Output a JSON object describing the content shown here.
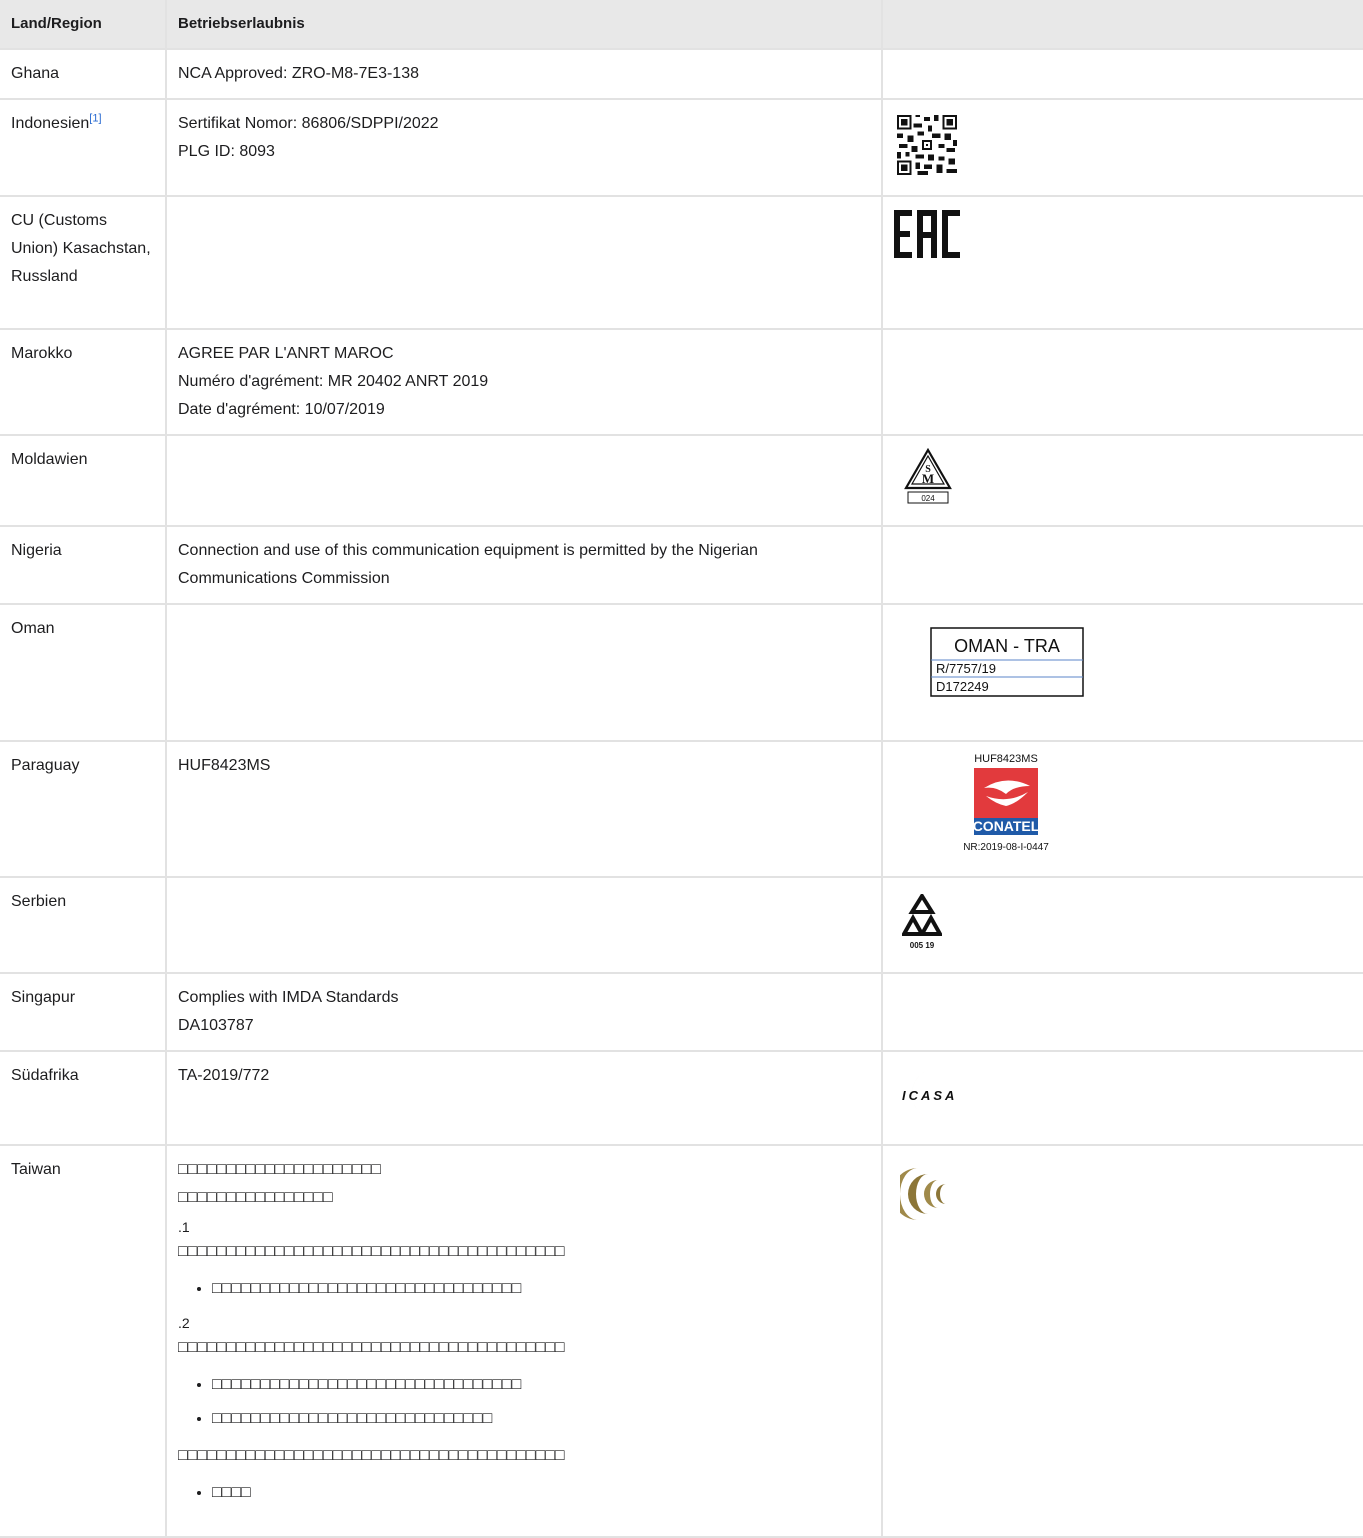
{
  "header": {
    "col1": "Land/Region",
    "col2": "Betriebserlaubnis",
    "col3": ""
  },
  "rows": [
    {
      "country": "Ghana",
      "permit_lines": [
        "NCA Approved: ZRO-M8-7E3-138"
      ]
    },
    {
      "country": "Indonesien",
      "footnote": "[1]",
      "permit_lines": [
        "Sertifikat Nomor: 86806/SDPPI/2022",
        "PLG ID: 8093"
      ],
      "mark": "qr-code"
    },
    {
      "country": "CU (Customs Union) Kasachstan, Russland",
      "permit_lines": [],
      "mark": "eac-mark",
      "mark_text": "EAC"
    },
    {
      "country": "Marokko",
      "permit_lines": [
        "AGREE PAR L'ANRT MAROC",
        "Numéro d'agrément: MR 20402 ANRT 2019",
        "Date d'agrément: 10/07/2019"
      ]
    },
    {
      "country": "Moldawien",
      "permit_lines": [],
      "mark": "sm-mark",
      "mark_text": [
        "S",
        "M",
        "024"
      ]
    },
    {
      "country": "Nigeria",
      "permit_lines": [
        "Connection and use of this communication equipment is permitted by the Nigerian Communications Commission"
      ]
    },
    {
      "country": "Oman",
      "permit_lines": [],
      "mark": "oman-tra-label",
      "mark_text": [
        "OMAN - TRA",
        "R/7757/19",
        "D172249"
      ]
    },
    {
      "country": "Paraguay",
      "permit_lines": [
        "HUF8423MS"
      ],
      "mark": "conatel-logo",
      "mark_text": [
        "HUF8423MS",
        "CONATEL",
        "NR:2019-08-I-0447"
      ]
    },
    {
      "country": "Serbien",
      "permit_lines": [],
      "mark": "serbia-triangle-mark",
      "mark_text": "005 19"
    },
    {
      "country": "Singapur",
      "permit_lines": [
        "Complies with IMDA Standards",
        "DA103787"
      ]
    },
    {
      "country": "Südafrika",
      "permit_lines": [
        "TA-2019/772"
      ],
      "mark": "icasa-logo",
      "mark_text": "ICASA"
    },
    {
      "country": "Taiwan",
      "mark": "ncc-logo"
    }
  ],
  "taiwan": {
    "line1": "□□□□□□□□□□□□□□□□□□□□□",
    "line2": "□□□□□□□□□□□□□□□□",
    "num1": ".1",
    "para1": "□□□□□□□□□□□□□□□□□□□□□□□□□□□□□□□□□□□□□□□□",
    "bullets1": [
      "□□□□□□□□□□□□□□□□□□□□□□□□□□□□□□□□"
    ],
    "num2": ".2",
    "para2": "□□□□□□□□□□□□□□□□□□□□□□□□□□□□□□□□□□□□□□□□",
    "bullets2": [
      "□□□□□□□□□□□□□□□□□□□□□□□□□□□□□□□□",
      "□□□□□□□□□□□□□□□□□□□□□□□□□□□□□"
    ],
    "para3": "□□□□□□□□□□□□□□□□□□□□□□□□□□□□□□□□□□□□□□□□",
    "bullets3": [
      "□□□□"
    ]
  }
}
